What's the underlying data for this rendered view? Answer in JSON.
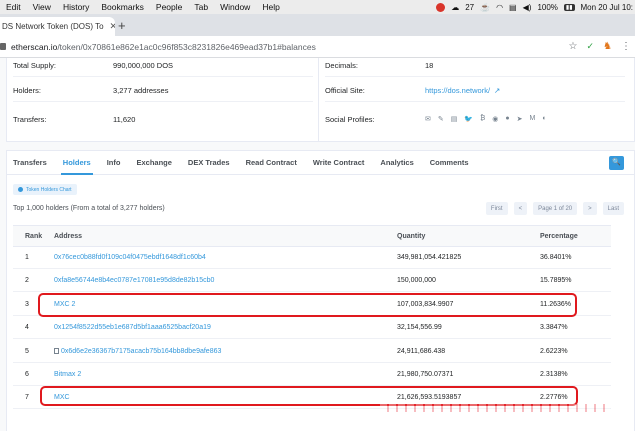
{
  "menubar": {
    "items": [
      "Edit",
      "View",
      "History",
      "Bookmarks",
      "People",
      "Tab",
      "Window",
      "Help"
    ],
    "status": {
      "count": "27",
      "battery": "100%",
      "datetime": "Mon 20 Jul 10:"
    }
  },
  "browser": {
    "tab_title": "DS Network Token (DOS) To",
    "new_tab": "+",
    "url_host": "etherscan.io",
    "url_path": "/token/0x70861e862e1ac0c96f853c8231826e469ead37b1#balances"
  },
  "overview": {
    "total_supply_label": "Total Supply:",
    "total_supply_value": "990,000,000 DOS",
    "holders_label": "Holders:",
    "holders_value": "3,277 addresses",
    "transfers_label": "Transfers:",
    "transfers_value": "11,620"
  },
  "profile": {
    "decimals_label": "Decimals:",
    "decimals_value": "18",
    "official_site_label": "Official Site:",
    "official_site_value": "https://dos.network/",
    "social_label": "Social Profiles:"
  },
  "tabs": [
    "Transfers",
    "Holders",
    "Info",
    "Exchange",
    "DEX Trades",
    "Read Contract",
    "Write Contract",
    "Analytics",
    "Comments"
  ],
  "holders": {
    "chart_button": "Token Holders Chart",
    "note": "Top 1,000 holders (From a total of 3,277 holders)",
    "pager": {
      "first": "First",
      "prev": "<",
      "page": "Page 1 of 20",
      "next": ">",
      "last": "Last"
    },
    "columns": [
      "Rank",
      "Address",
      "Quantity",
      "Percentage"
    ],
    "rows": [
      {
        "rank": "1",
        "address": "0x76cec0b88fd0f109c04f0475ebdf1648df1c60b4",
        "quantity": "349,981,054.421825",
        "percentage": "36.8401%"
      },
      {
        "rank": "2",
        "address": "0xfa8e56744e8b4ec0787e17081e95d8de82b15cb0",
        "quantity": "150,000,000",
        "percentage": "15.7895%"
      },
      {
        "rank": "3",
        "address": "MXC 2",
        "quantity": "107,003,834.9907",
        "percentage": "11.2636%"
      },
      {
        "rank": "4",
        "address": "0x1254f8522d55eb1e687d5bf1aaa6525bacf20a19",
        "quantity": "32,154,556.99",
        "percentage": "3.3847%"
      },
      {
        "rank": "5",
        "address": "0x6d6e2e36367b7175acacb75b164bb8dbe9afe863",
        "quantity": "24,911,686.438",
        "percentage": "2.6223%"
      },
      {
        "rank": "6",
        "address": "Bitmax 2",
        "quantity": "21,980,750.07371",
        "percentage": "2.3138%"
      },
      {
        "rank": "7",
        "address": "MXC",
        "quantity": "21,626,593.5193857",
        "percentage": "2.2776%"
      }
    ]
  },
  "colors": {
    "accent": "#3498db",
    "highlight": "#e0191e"
  }
}
